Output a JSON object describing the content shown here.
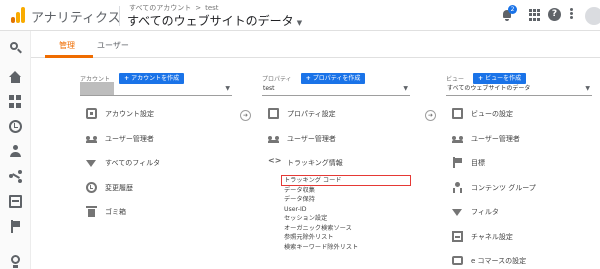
{
  "app": {
    "name": "アナリティクス",
    "breadcrumb": [
      "すべてのアカウント",
      "test"
    ],
    "title": "すべてのウェブサイトのデータ",
    "notification_count": "2"
  },
  "tabs": [
    {
      "label": "管理",
      "active": true
    },
    {
      "label": "ユーザー",
      "active": false
    }
  ],
  "account": {
    "label": "アカウント",
    "create_label": "アカウントを作成",
    "selected": "",
    "items": [
      {
        "icon": "gear-icon",
        "label": "アカウント設定"
      },
      {
        "icon": "users-icon",
        "label": "ユーザー管理者"
      },
      {
        "icon": "filter-icon",
        "label": "すべてのフィルタ"
      },
      {
        "icon": "history-icon",
        "label": "変更履歴"
      },
      {
        "icon": "trash-icon",
        "label": "ゴミ箱"
      }
    ]
  },
  "property": {
    "label": "プロパティ",
    "create_label": "プロパティを作成",
    "selected": "test",
    "items": [
      {
        "icon": "settings-icon",
        "label": "プロパティ設定"
      },
      {
        "icon": "users-icon",
        "label": "ユーザー管理者"
      },
      {
        "icon": "code-icon",
        "label": "トラッキング情報"
      }
    ],
    "tracking_sub": [
      "トラッキング コード",
      "データ収集",
      "データ保持",
      "User-ID",
      "セッション設定",
      "オーガニック検索ソース",
      "参照元除外リスト",
      "検索キーワード除外リスト"
    ],
    "highlighted_sub_index": 0
  },
  "view": {
    "label": "ビュー",
    "create_label": "ビューを作成",
    "selected": "すべてのウェブサイトのデータ",
    "items": [
      {
        "icon": "settings-icon",
        "label": "ビューの設定"
      },
      {
        "icon": "users-icon",
        "label": "ユーザー管理者"
      },
      {
        "icon": "flag-icon",
        "label": "目標"
      },
      {
        "icon": "content-group-icon",
        "label": "コンテンツ グループ"
      },
      {
        "icon": "filter-icon",
        "label": "フィルタ"
      },
      {
        "icon": "channel-icon",
        "label": "チャネル設定"
      },
      {
        "icon": "ecommerce-icon",
        "label": "e コマースの設定"
      }
    ]
  },
  "colors": {
    "accent": "#ef6c00",
    "primary": "#1a73e8",
    "highlight": "#e53935"
  }
}
